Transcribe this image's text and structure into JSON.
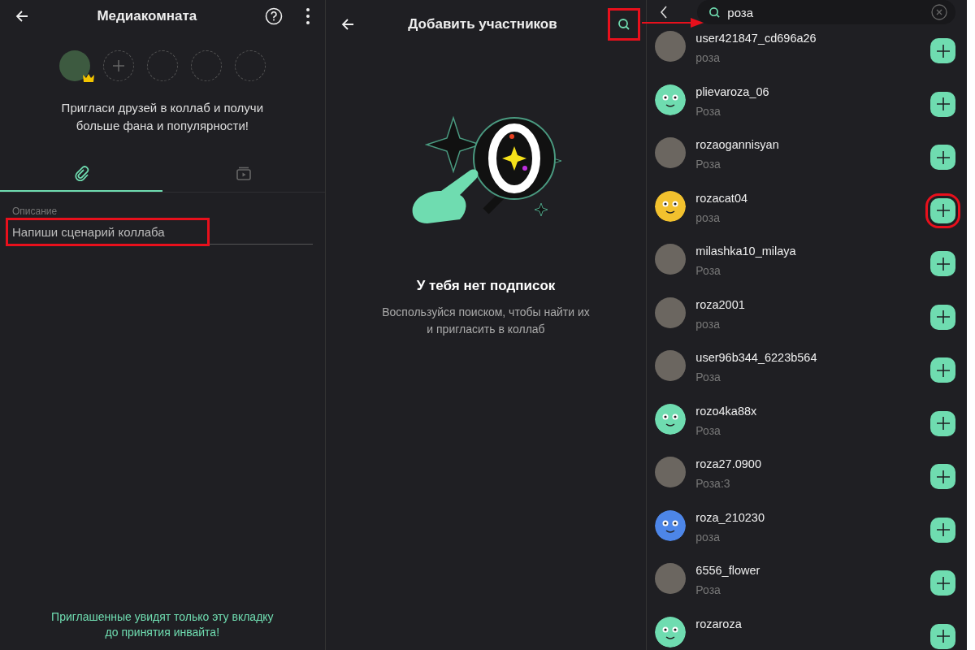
{
  "left_panel": {
    "title": "Медиакомната",
    "slots": [
      {
        "kind": "owner"
      },
      {
        "kind": "add"
      },
      {
        "kind": "empty"
      },
      {
        "kind": "empty"
      },
      {
        "kind": "empty"
      }
    ],
    "invite_text": "Пригласи друзей в коллаб и получи больше фана и популярности!",
    "tabs": [
      {
        "kind": "attachment",
        "selected": true
      },
      {
        "kind": "video",
        "selected": false
      }
    ],
    "description": {
      "label": "Описание",
      "placeholder": "Напиши сценарий коллаба",
      "highlighted": true
    },
    "footer_note": "Приглашенные увидят только эту вкладку до принятия инвайта!"
  },
  "middle_panel": {
    "title": "Добавить участников",
    "search_highlighted": true,
    "empty_title": "У тебя нет подписок",
    "empty_text": "Воспользуйся поиском, чтобы найти их и пригласить в коллаб"
  },
  "right_panel": {
    "search": {
      "value": "роза"
    },
    "results": [
      {
        "name": "user421847_cd696a26",
        "subtitle": "роза",
        "avatar": {
          "kind": "photo"
        },
        "highlighted": false
      },
      {
        "name": "plievaroza_06",
        "subtitle": "Роза",
        "avatar": {
          "kind": "face",
          "color": "#6fdcb0"
        },
        "highlighted": false
      },
      {
        "name": "rozaogannisyan",
        "subtitle": "Роза",
        "avatar": {
          "kind": "photo"
        },
        "highlighted": false
      },
      {
        "name": "rozacat04",
        "subtitle": "роза",
        "avatar": {
          "kind": "face",
          "color": "#f2c12e"
        },
        "highlighted": true
      },
      {
        "name": "milashka10_milaya",
        "subtitle": "Роза",
        "avatar": {
          "kind": "photo"
        },
        "highlighted": false
      },
      {
        "name": "roza2001",
        "subtitle": "роза",
        "avatar": {
          "kind": "photo"
        },
        "highlighted": false
      },
      {
        "name": "user96b344_6223b564",
        "subtitle": "Роза",
        "avatar": {
          "kind": "photo"
        },
        "highlighted": false
      },
      {
        "name": "rozo4ka88x",
        "subtitle": "Роза",
        "avatar": {
          "kind": "face",
          "color": "#6fdcb0"
        },
        "highlighted": false
      },
      {
        "name": "roza27.0900",
        "subtitle": "Роза:3",
        "avatar": {
          "kind": "photo"
        },
        "highlighted": false
      },
      {
        "name": "roza_210230",
        "subtitle": "роза",
        "avatar": {
          "kind": "face",
          "color": "#4d86e8"
        },
        "highlighted": false
      },
      {
        "name": "6556_flower",
        "subtitle": "Роза",
        "avatar": {
          "kind": "photo"
        },
        "highlighted": false
      },
      {
        "name": "rozaroza",
        "avatar": {
          "kind": "face",
          "color": "#6fdcb0"
        },
        "highlighted": false
      }
    ]
  }
}
